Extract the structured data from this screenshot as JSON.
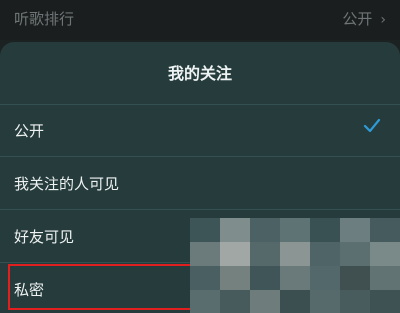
{
  "background_row": {
    "left_label": "听歌排行",
    "right_label": "公开",
    "chevron_icon": "chevron-right-icon"
  },
  "sheet": {
    "title": "我的关注",
    "options": [
      {
        "label": "公开",
        "selected": true
      },
      {
        "label": "我关注的人可见",
        "selected": false
      },
      {
        "label": "好友可见",
        "selected": false
      },
      {
        "label": "私密",
        "selected": false
      }
    ],
    "check_icon": "checkmark-icon",
    "highlight_color": "#e21f1f",
    "check_color": "#2f9bd6"
  }
}
